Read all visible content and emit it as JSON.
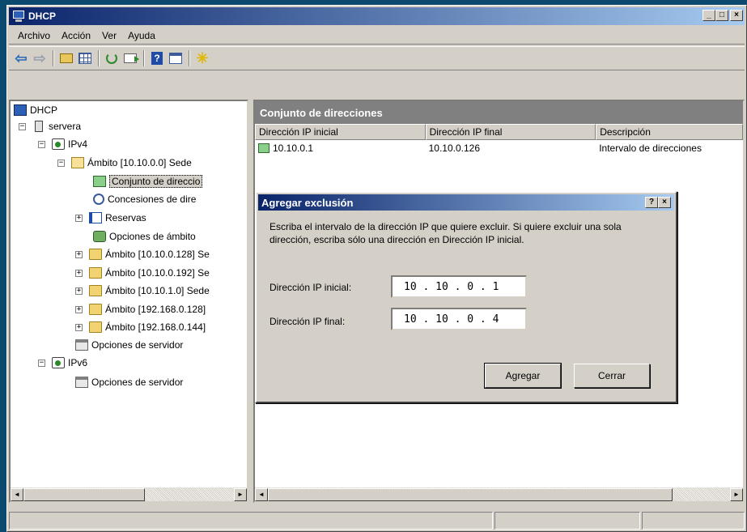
{
  "window": {
    "title": "DHCP"
  },
  "menubar": [
    "Archivo",
    "Acción",
    "Ver",
    "Ayuda"
  ],
  "tree": {
    "root": "DHCP",
    "server": "servera",
    "ipv4": "IPv4",
    "scope_main": "Ámbito [10.10.0.0] Sede",
    "pool": "Conjunto de direccio",
    "leases": "Concesiones de dire",
    "reservations": "Reservas",
    "scope_options": "Opciones de ámbito",
    "scopes": [
      "Ámbito [10.10.0.128] Se",
      "Ámbito [10.10.0.192] Se",
      "Ámbito [10.10.1.0] Sede",
      "Ámbito [192.168.0.128]",
      "Ámbito [192.168.0.144]"
    ],
    "server_options_v4": "Opciones de servidor",
    "ipv6": "IPv6",
    "server_options_v6": "Opciones de servidor"
  },
  "detail": {
    "header": "Conjunto de direcciones",
    "columns": [
      "Dirección IP inicial",
      "Dirección IP final",
      "Descripción"
    ],
    "rows": [
      {
        "start": "10.10.0.1",
        "end": "10.10.0.126",
        "desc": "Intervalo de direcciones"
      }
    ]
  },
  "dialog": {
    "title": "Agregar exclusión",
    "help_btn": "?",
    "close_btn": "×",
    "description": "Escriba el intervalo de la dirección IP que quiere excluir. Si quiere excluir una sola dirección, escriba sólo una dirección en Dirección IP inicial.",
    "start_label": "Dirección IP inicial:",
    "start_value": "10 . 10 . 0 . 1",
    "end_label": "Dirección IP final:",
    "end_value": "10 . 10 . 0 . 4",
    "add_button": "Agregar",
    "close_button": "Cerrar"
  },
  "window_buttons": {
    "minimize": "_",
    "maximize": "□",
    "close": "×"
  },
  "scroll_arrows": {
    "left": "◄",
    "right": "►"
  },
  "expander": {
    "collapsed": "+",
    "expanded": "−"
  }
}
